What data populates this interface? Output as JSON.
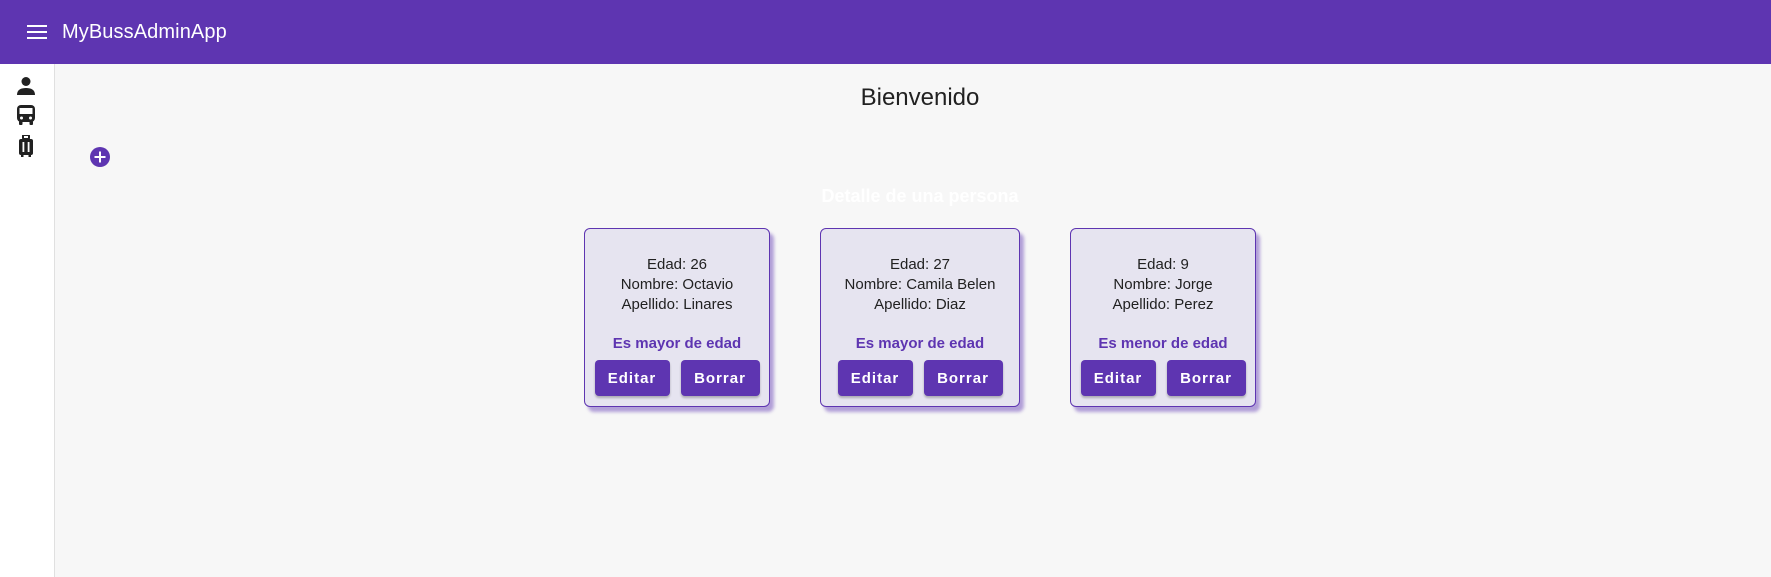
{
  "app": {
    "title": "MyBussAdminApp"
  },
  "icons": {
    "menu": "menu-icon",
    "person": "person-icon",
    "bus": "bus-icon",
    "luggage": "luggage-icon",
    "add": "add-circle-icon"
  },
  "colors": {
    "primary": "#5e35b1",
    "card_bg": "#e6e4f0",
    "page_bg": "#f7f7f7"
  },
  "main": {
    "welcome": "Bienvenido",
    "detail_title": "Detalle de una persona"
  },
  "cards": [
    {
      "edad": "Edad: 26",
      "nombre": "Nombre: Octavio",
      "apellido": "Apellido: Linares",
      "status": "Es mayor de edad",
      "edit": "Editar",
      "delete": "Borrar"
    },
    {
      "edad": "Edad: 27",
      "nombre": "Nombre: Camila Belen",
      "apellido": "Apellido: Diaz",
      "status": "Es mayor de edad",
      "edit": "Editar",
      "delete": "Borrar"
    },
    {
      "edad": "Edad: 9",
      "nombre": "Nombre: Jorge",
      "apellido": "Apellido: Perez",
      "status": "Es menor de edad",
      "edit": "Editar",
      "delete": "Borrar"
    }
  ]
}
